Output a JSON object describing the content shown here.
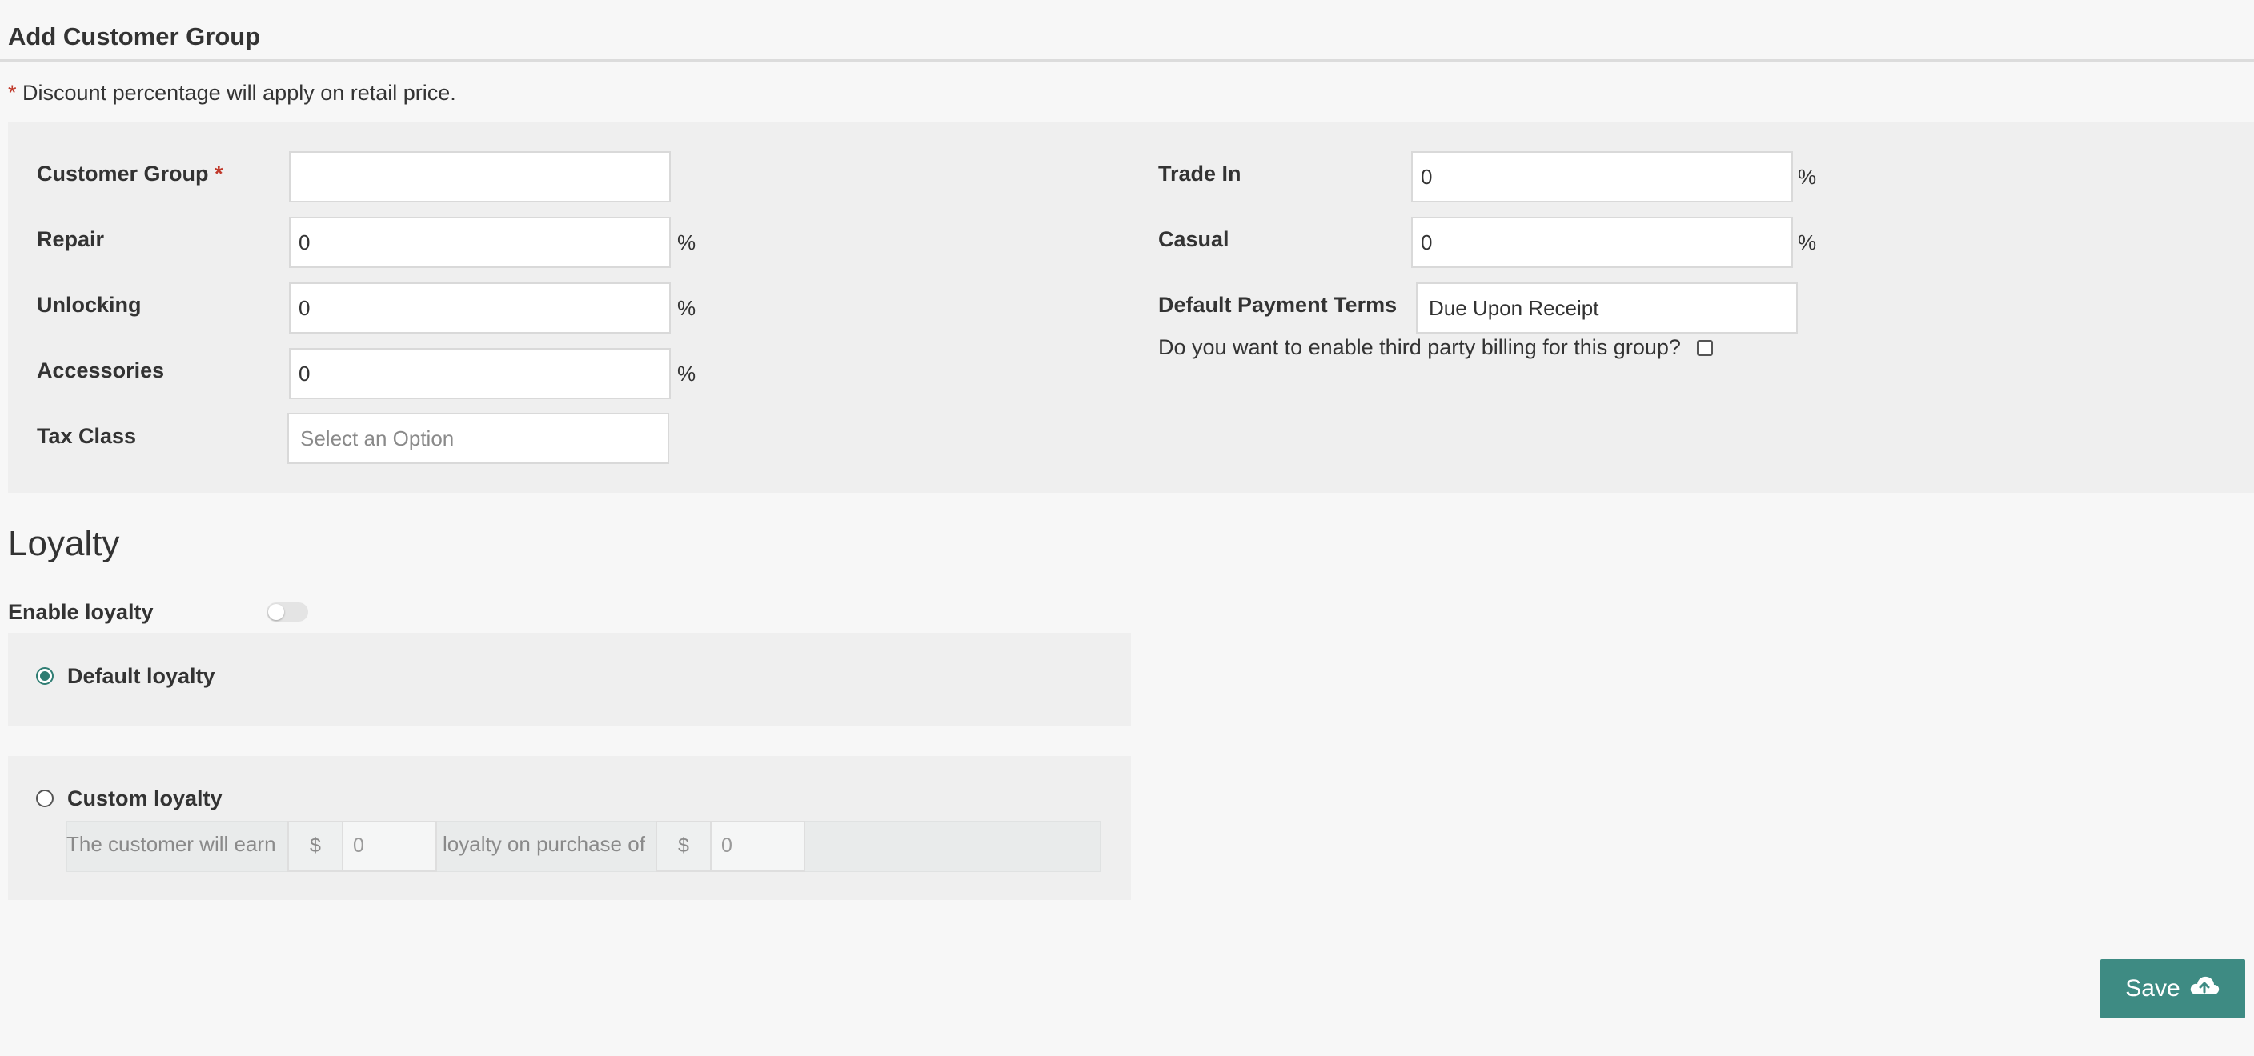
{
  "page": {
    "title": "Add Customer Group",
    "note_star": "*",
    "note": " Discount percentage will apply on retail price."
  },
  "form": {
    "customer_group": {
      "label": "Customer Group",
      "required_mark": "*",
      "value": ""
    },
    "repair": {
      "label": "Repair",
      "value": "0",
      "unit": "%"
    },
    "unlocking": {
      "label": "Unlocking",
      "value": "0",
      "unit": "%"
    },
    "accessories": {
      "label": "Accessories",
      "value": "0",
      "unit": "%"
    },
    "tax_class": {
      "label": "Tax Class",
      "placeholder": "Select an Option"
    },
    "trade_in": {
      "label": "Trade In",
      "value": "0",
      "unit": "%"
    },
    "casual": {
      "label": "Casual",
      "value": "0",
      "unit": "%"
    },
    "payment_terms": {
      "label": "Default Payment Terms",
      "value": "Due Upon Receipt"
    },
    "third_party": {
      "label": "Do you want to enable third party billing for this group?",
      "checked": false
    }
  },
  "loyalty": {
    "heading": "Loyalty",
    "enable_label": "Enable loyalty",
    "enabled": false,
    "default_label": "Default loyalty",
    "default_selected": true,
    "custom_label": "Custom loyalty",
    "earn_text": "The customer will earn",
    "currency": "$",
    "earn_value": "0",
    "purchase_text": "loyalty on purchase of",
    "purchase_value": "0"
  },
  "actions": {
    "save_label": "Save"
  },
  "colors": {
    "accent": "#3e8b83",
    "required": "#c0392b",
    "background": "#f7f7f7",
    "panel": "#efefef"
  }
}
